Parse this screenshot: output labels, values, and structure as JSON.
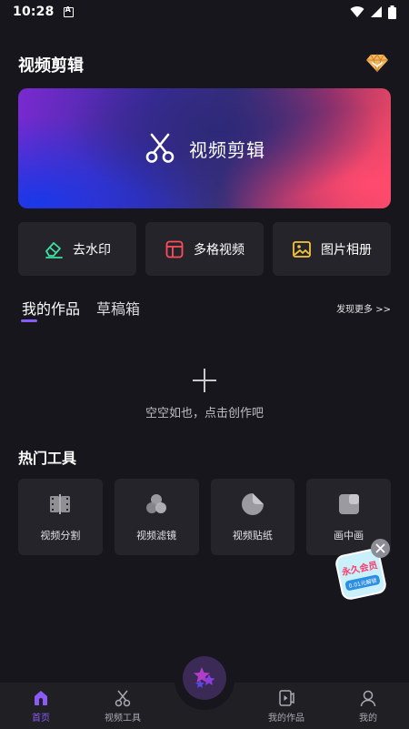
{
  "status_bar": {
    "time": "10:28"
  },
  "header": {
    "title": "视频剪辑"
  },
  "hero": {
    "label": "视频剪辑"
  },
  "quick_actions": [
    {
      "label": "去水印",
      "icon": "eraser-icon",
      "color": "#3ee0a0"
    },
    {
      "label": "多格视频",
      "icon": "grid-icon",
      "color": "#ff4d5e"
    },
    {
      "label": "图片相册",
      "icon": "image-icon",
      "color": "#f4c43a"
    }
  ],
  "works_tabs": {
    "active": "我的作品",
    "inactive": "草稿箱",
    "more": "发现更多 >>"
  },
  "empty_state": {
    "text": "空空如也，点击创作吧"
  },
  "hot_tools": {
    "title": "热门工具",
    "items": [
      {
        "label": "视频分割",
        "icon": "film-split-icon"
      },
      {
        "label": "视频滤镜",
        "icon": "filter-icon"
      },
      {
        "label": "视频贴纸",
        "icon": "sticker-icon"
      },
      {
        "label": "画中画",
        "icon": "picture-in-picture-icon"
      }
    ]
  },
  "promo": {
    "title": "永久会员",
    "subtitle": "0.01元解锁"
  },
  "bottom_nav": {
    "home": "首页",
    "tools": "视频工具",
    "works": "我的作品",
    "profile": "我的"
  },
  "colors": {
    "accent": "#8a5cf5",
    "background": "#16161c",
    "card": "#24242a"
  }
}
